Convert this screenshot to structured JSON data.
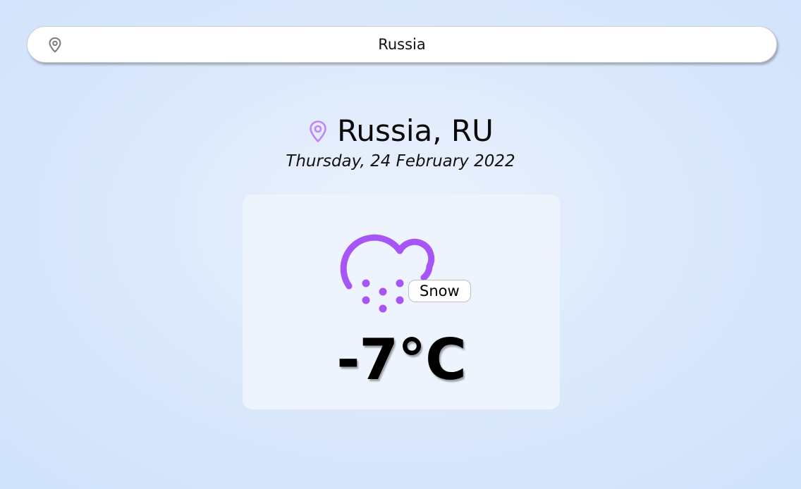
{
  "search": {
    "value": "Russia",
    "icon": "map-pin-icon"
  },
  "location": {
    "name": "Russia, RU",
    "icon": "map-pin-icon",
    "icon_color": "#c084fc"
  },
  "date": "Thursday, 24 February 2022",
  "weather": {
    "icon": "snow-cloud-icon",
    "icon_color": "#a855f7",
    "condition": "Snow",
    "temperature": "-7°C"
  },
  "colors": {
    "accent": "#a855f7",
    "background": "#d6e6fc",
    "card": "#eef4fd"
  }
}
